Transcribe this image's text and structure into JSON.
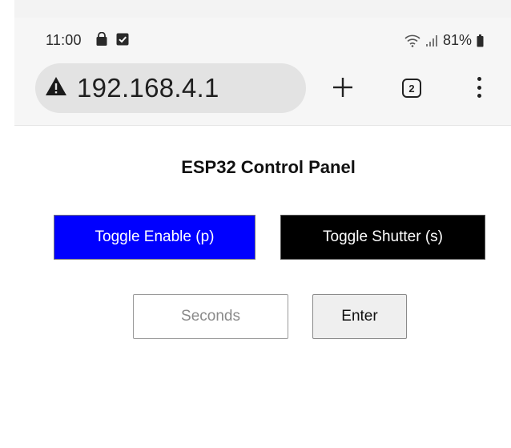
{
  "status_bar": {
    "time": "11:00",
    "battery": "81%"
  },
  "browser": {
    "url": "192.168.4.1",
    "tab_count": "2"
  },
  "page": {
    "title": "ESP32 Control Panel",
    "toggle_enable_label": "Toggle Enable (p)",
    "toggle_shutter_label": "Toggle Shutter (s)",
    "seconds_placeholder": "Seconds",
    "enter_label": "Enter"
  },
  "colors": {
    "enable_button_bg": "#0000ff",
    "shutter_button_bg": "#000000"
  },
  "icons": {
    "status_left": [
      "shopping-bag-icon",
      "checkbox-icon"
    ],
    "status_right": [
      "wifi-icon",
      "signal-icon",
      "battery-icon"
    ],
    "address": "warning-icon",
    "toolbar": [
      "plus-icon",
      "tabs-icon",
      "more-vert-icon"
    ]
  }
}
